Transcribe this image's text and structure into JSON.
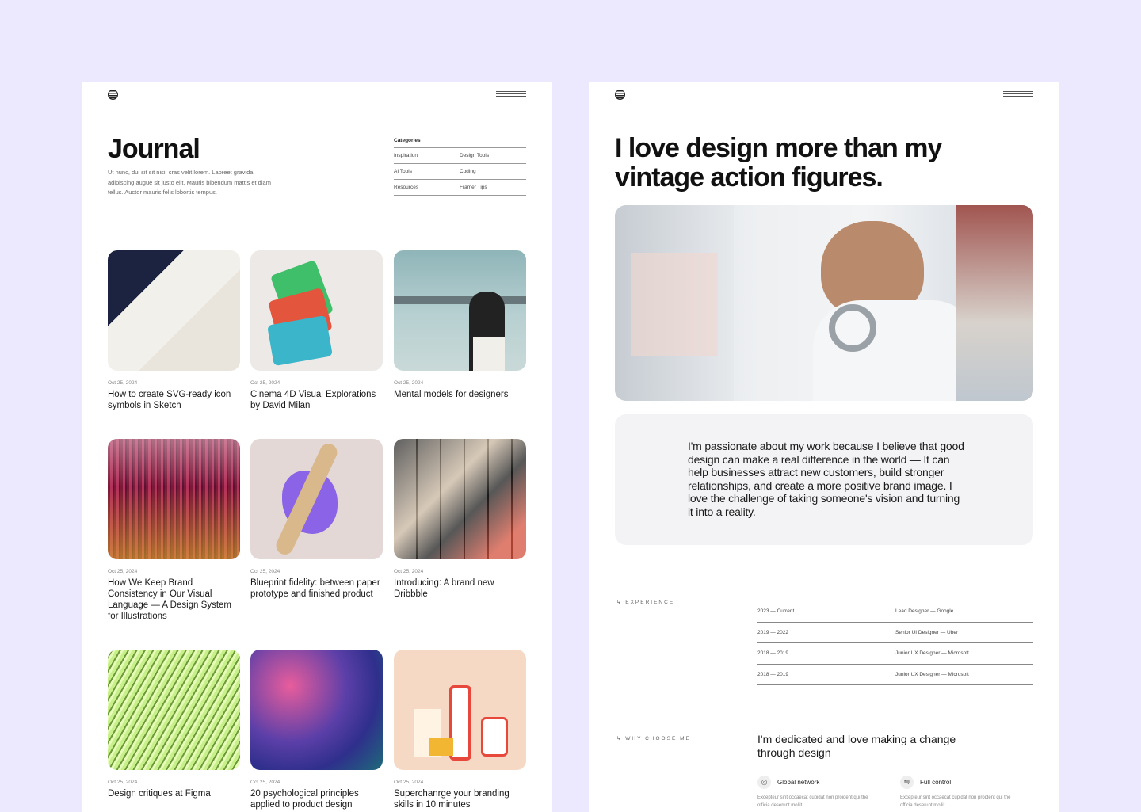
{
  "journal": {
    "title": "Journal",
    "description": "Ut nunc, dui sit sit nisi, cras velit lorem. Laoreet gravida adipiscing augue sit justo elit. Mauris bibendum mattis et diam tellus. Auctor mauris felis lobortis tempus.",
    "categories_title": "Categories",
    "categories": [
      [
        "Inspiration",
        "Design Tools"
      ],
      [
        "AI Tools",
        "Coding"
      ],
      [
        "Resources",
        "Framer Tips"
      ]
    ],
    "posts": [
      {
        "date": "Oct 25, 2024",
        "title": "How to create SVG-ready icon symbols in Sketch"
      },
      {
        "date": "Oct 25, 2024",
        "title": "Cinema 4D Visual Explorations by David Milan"
      },
      {
        "date": "Oct 25, 2024",
        "title": "Mental models for designers"
      },
      {
        "date": "Oct 25, 2024",
        "title": "How We Keep Brand Consistency in Our Visual Language — A Design System for Illustrations"
      },
      {
        "date": "Oct 25, 2024",
        "title": "Blueprint fidelity: between paper prototype and finished product"
      },
      {
        "date": "Oct 25, 2024",
        "title": "Introducing: A brand new Dribbble"
      },
      {
        "date": "Oct 25, 2024",
        "title": "Design critiques at Figma"
      },
      {
        "date": "Oct 25, 2024",
        "title": "20 psychological principles applied to product design"
      },
      {
        "date": "Oct 25, 2024",
        "title": "Superchanrge your branding skills in 10 minutes"
      }
    ]
  },
  "about": {
    "title": "I love design more than my vintage action figures.",
    "quote": "I'm passionate about my work because I believe that good design can make a real difference in the world — It can help businesses attract new customers, build stronger relationships, and create a more positive brand image. I love the challenge of taking someone's vision and turning it into a reality.",
    "experience_label": "↳ EXPERIENCE",
    "experience": [
      {
        "period": "2023 — Current",
        "role": "Lead Designer — Google"
      },
      {
        "period": "2019 — 2022",
        "role": "Senior UI Designer — Uber"
      },
      {
        "period": "2018 — 2019",
        "role": "Junior UX Designer — Microsoft"
      },
      {
        "period": "2018 — 2019",
        "role": "Junior UX Designer — Microsoft"
      }
    ],
    "why_label": "↳ WHY CHOOSE ME",
    "why_title": "I'm dedicated and love making a change through design",
    "features": [
      {
        "icon": "globe-icon",
        "title": "Global network",
        "desc": "Excepteur sint occaecat cupidat non proident qui the officia deserunt mollit."
      },
      {
        "icon": "sliders-icon",
        "title": "Full control",
        "desc": "Excepteur sint occaecat cupidat non proident qui the officia deserunt mollit."
      }
    ]
  }
}
